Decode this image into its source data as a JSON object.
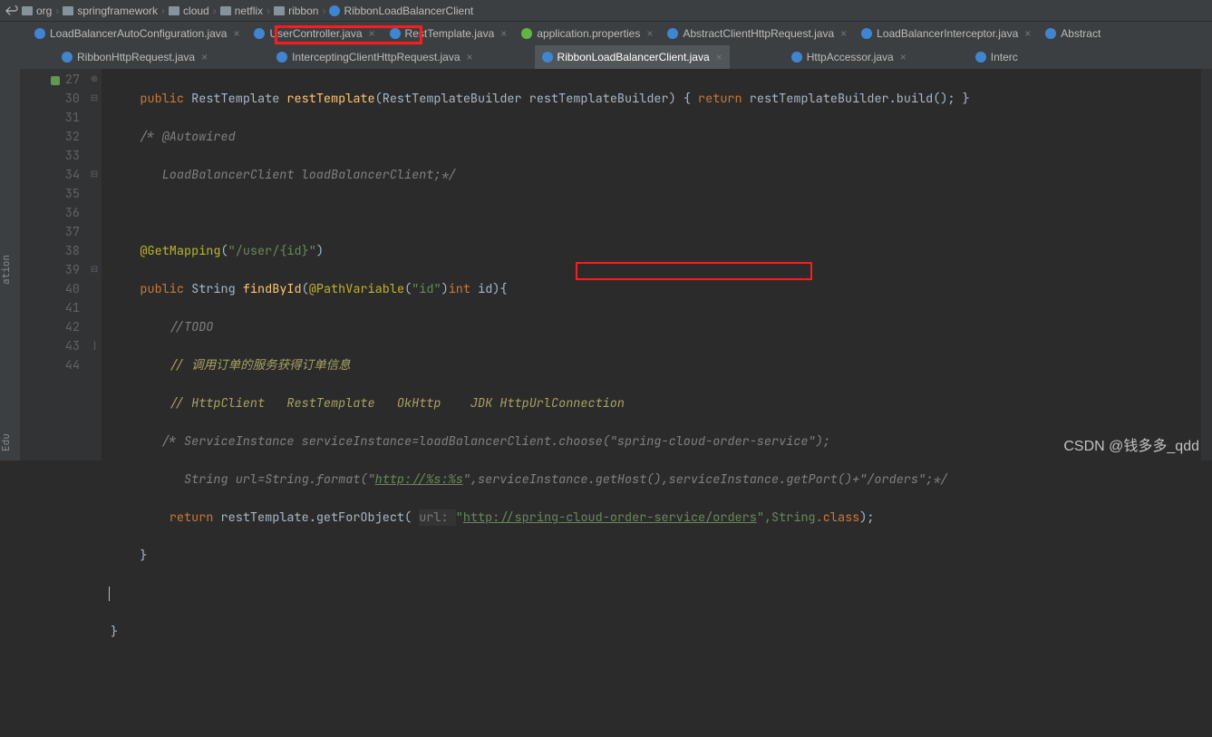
{
  "breadcrumb": [
    "org",
    "springframework",
    "cloud",
    "netflix",
    "ribbon",
    "RibbonLoadBalancerClient"
  ],
  "tabsRow1": [
    {
      "label": "LoadBalancerAutoConfiguration.java",
      "icon": "j-blue"
    },
    {
      "label": "UserController.java",
      "icon": "j-blue"
    },
    {
      "label": "RestTemplate.java",
      "icon": "j-blue"
    },
    {
      "label": "application.properties",
      "icon": "j-green"
    },
    {
      "label": "AbstractClientHttpRequest.java",
      "icon": "j-blue"
    },
    {
      "label": "LoadBalancerInterceptor.java",
      "icon": "j-blue"
    },
    {
      "label": "Abstract",
      "icon": "j-blue"
    }
  ],
  "tabsRow2": [
    {
      "label": "RibbonHttpRequest.java",
      "icon": "j-blue"
    },
    {
      "label": "InterceptingClientHttpRequest.java",
      "icon": "j-blue"
    },
    {
      "label": "RibbonLoadBalancerClient.java",
      "icon": "j-blue",
      "active": true
    },
    {
      "label": "HttpAccessor.java",
      "icon": "j-blue"
    },
    {
      "label": "Interc",
      "icon": "j-blue"
    }
  ],
  "sidebar": {
    "top": "Edu",
    "bottom": "ation"
  },
  "gutter": {
    "start": 27
  },
  "code": {
    "l27": {
      "kw_public": "public",
      "restTemplateType": " RestTemplate ",
      "restTemplate_fn": "restTemplate",
      "sig": "(RestTemplateBuilder restTemplateBuilder) { ",
      "kw_return": "return",
      "ret": " restTemplateBuilder.build(); }"
    },
    "l30": "/* @Autowired",
    "l31": "   LoadBalancerClient loadBalancerClient;*/",
    "l33": {
      "ann": "@GetMapping",
      "args": "(",
      "str": "\"/user/{id}\"",
      "close": ")"
    },
    "l34": {
      "kw_public": "public",
      "sig": " String ",
      "fn": "findById",
      "open": "(",
      "ann": "@PathVariable",
      "annArg": "(",
      "str": "\"id\"",
      "annClose": ")",
      "kw_int": "int ",
      "param": "id",
      "close": "){"
    },
    "l35": "//TODO",
    "l36": "// 调用订单的服务获得订单信息",
    "l37": "// HttpClient   RestTemplate   OkHttp    JDK HttpUrlConnection",
    "l38": "/* ServiceInstance serviceInstance=loadBalancerClient.choose(\"spring-cloud-order-service\");",
    "l39": {
      "pre": "   String url=String.format(\"",
      "u": "http://%s:%s",
      "post": "\",serviceInstance.getHost(),serviceInstance.getPort()+\"/orders\";*/"
    },
    "l40": {
      "kw_return": "return",
      "pre": " restTemplate.getForObject( ",
      "hint": "url: ",
      "q": "\"",
      "u1": "http://",
      "u2": "spring-cloud-order-service",
      "u3": "/orders",
      "post": "\",String.",
      "kw_class": "class",
      "close": ");"
    },
    "l41": "}",
    "l43": "}"
  },
  "watermark": "CSDN @钱多多_qdd"
}
